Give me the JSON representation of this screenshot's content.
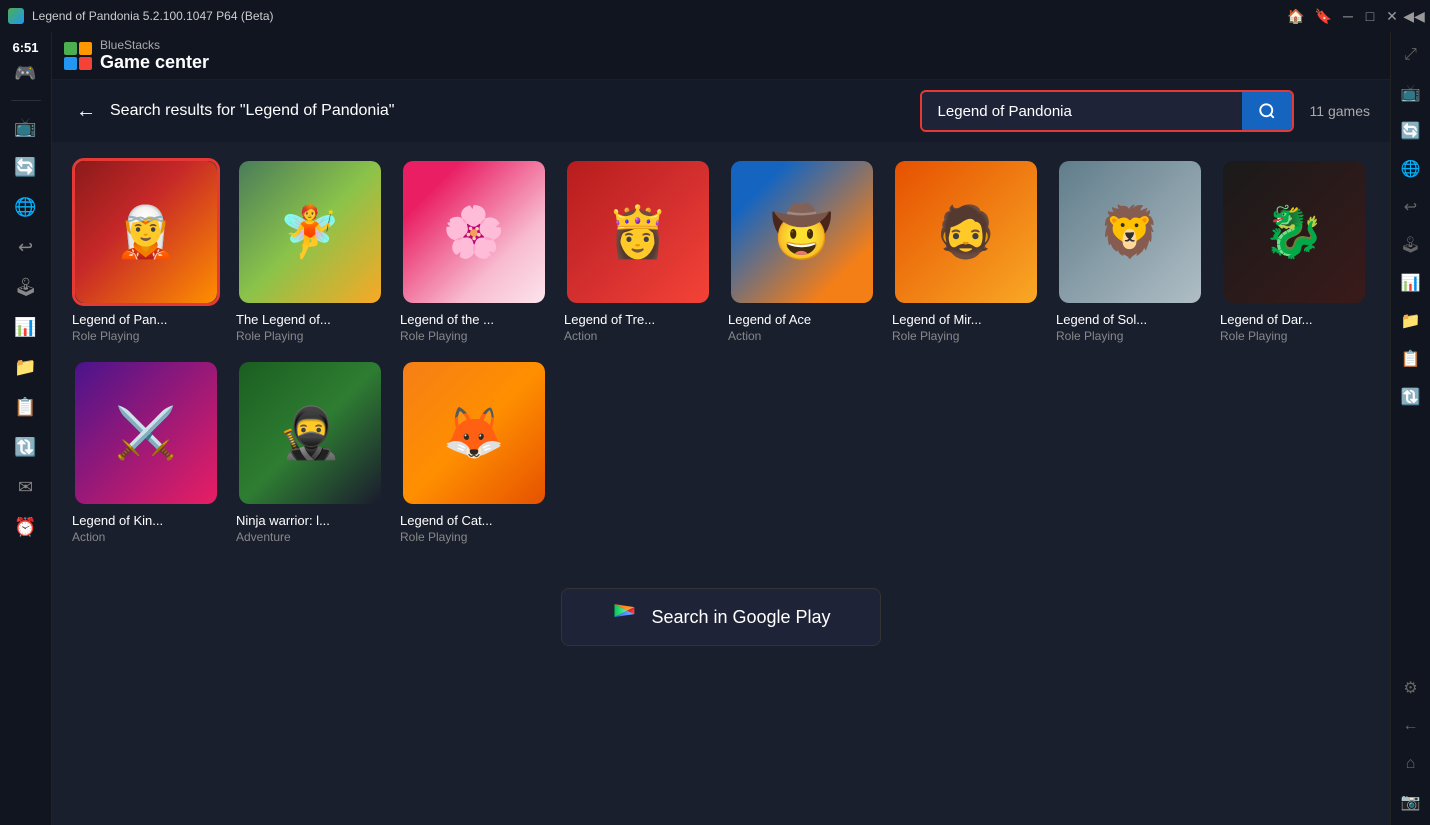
{
  "titleBar": {
    "appName": "Legend of Pandonia 5.2.100.1047 P64 (Beta)",
    "time": "6:51",
    "controls": [
      "minimize",
      "maximize",
      "close",
      "back"
    ]
  },
  "header": {
    "brand": "BlueStacks",
    "sectionTitle": "Game center"
  },
  "search": {
    "query": "Legend of Pandonia",
    "placeholder": "Legend of Pandonia",
    "searchButtonLabel": "🔍",
    "resultsLabel": "Search results for",
    "quotedQuery": "\"Legend of Pandonia\"",
    "gamesCount": "11 games"
  },
  "backButton": "←",
  "games": [
    {
      "id": 1,
      "name": "Legend of Pan...",
      "genre": "Role Playing",
      "selected": true,
      "thumbClass": "thumb-1",
      "icon": "🧝"
    },
    {
      "id": 2,
      "name": "The Legend of...",
      "genre": "Role Playing",
      "selected": false,
      "thumbClass": "thumb-2",
      "icon": "🧚"
    },
    {
      "id": 3,
      "name": "Legend of the ...",
      "genre": "Role Playing",
      "selected": false,
      "thumbClass": "thumb-3",
      "icon": "🌸"
    },
    {
      "id": 4,
      "name": "Legend of Tre...",
      "genre": "Action",
      "selected": false,
      "thumbClass": "thumb-4",
      "icon": "👸"
    },
    {
      "id": 5,
      "name": "Legend of Ace",
      "genre": "Action",
      "selected": false,
      "thumbClass": "thumb-5",
      "icon": "🤠"
    },
    {
      "id": 6,
      "name": "Legend of Mir...",
      "genre": "Role Playing",
      "selected": false,
      "thumbClass": "thumb-6",
      "icon": "🧔"
    },
    {
      "id": 7,
      "name": "Legend of Sol...",
      "genre": "Role Playing",
      "selected": false,
      "thumbClass": "thumb-7",
      "icon": "🦁"
    },
    {
      "id": 8,
      "name": "Legend of Dar...",
      "genre": "Role Playing",
      "selected": false,
      "thumbClass": "thumb-8",
      "icon": "🐉"
    },
    {
      "id": 9,
      "name": "Legend of Kin...",
      "genre": "Action",
      "selected": false,
      "thumbClass": "thumb-9",
      "icon": "⚔️"
    },
    {
      "id": 10,
      "name": "Ninja warrior: l...",
      "genre": "Adventure",
      "selected": false,
      "thumbClass": "thumb-10",
      "icon": "🥷"
    },
    {
      "id": 11,
      "name": "Legend of Cat...",
      "genre": "Role Playing",
      "selected": false,
      "thumbClass": "thumb-11",
      "icon": "🦊"
    }
  ],
  "googlePlayButton": {
    "label": "Search in Google Play",
    "icon": "▶"
  },
  "sidebarIcons": [
    "🌐",
    "📺",
    "⟳",
    "⟳",
    "🎮",
    "📊",
    "⚙",
    "📁",
    "📋",
    "🔄",
    "✉",
    "⟳"
  ],
  "rightSidebarIcons": [
    "⤢",
    "↕",
    "↙",
    "⌂",
    "📷",
    "⚙",
    "←"
  ]
}
